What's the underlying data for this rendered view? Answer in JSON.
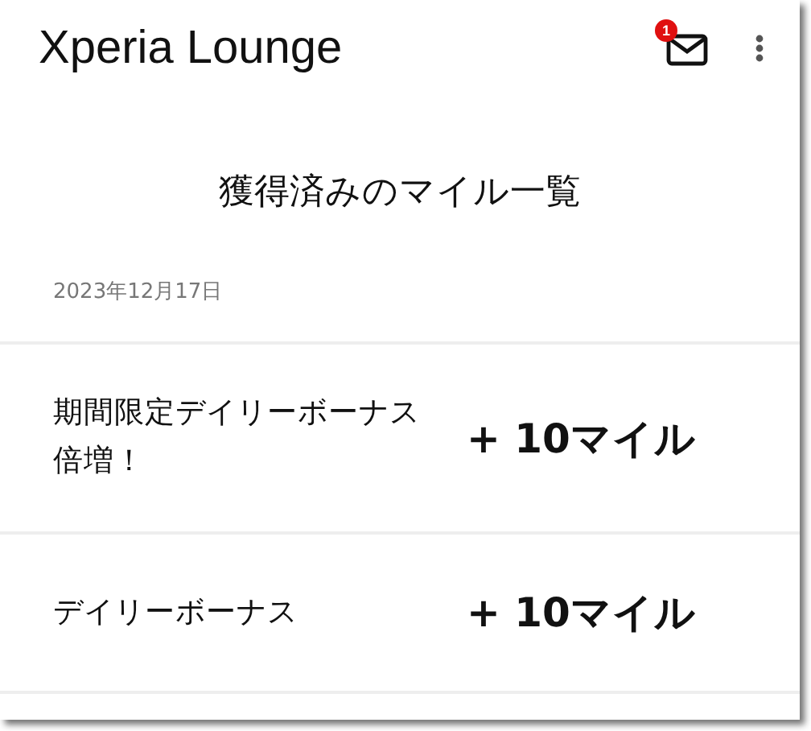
{
  "app_bar": {
    "title": "Xperia Lounge",
    "mail_badge": "1"
  },
  "page_title": "獲得済みのマイル一覧",
  "date": "2023年12月17日",
  "entries": [
    {
      "label": "期間限定デイリーボーナス倍増！",
      "amount": "+ 10マイル"
    },
    {
      "label": "デイリーボーナス",
      "amount": "+ 10マイル"
    }
  ]
}
